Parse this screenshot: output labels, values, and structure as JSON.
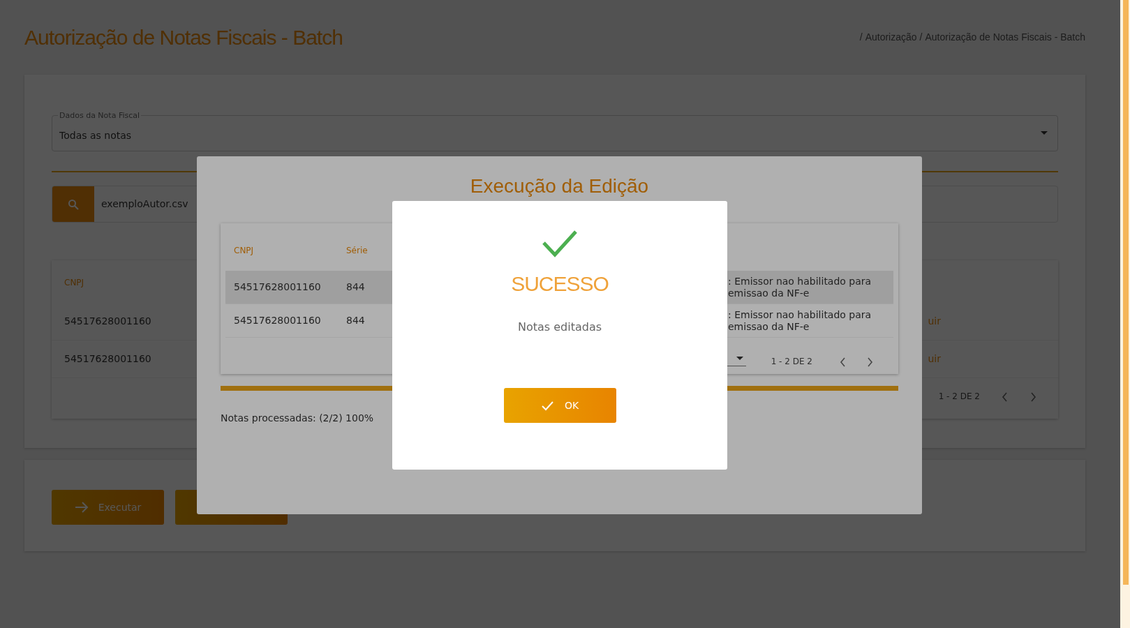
{
  "page": {
    "title": "Autorização de Notas Fiscais - Batch",
    "breadcrumb": {
      "separator": "/",
      "items": [
        "Autorização",
        "Autorização de Notas Fiscais - Batch"
      ]
    }
  },
  "filter": {
    "label": "Dados da Nota Fiscal",
    "value": "Todas as notas"
  },
  "file_search": {
    "value": "exemploAutor.csv"
  },
  "table": {
    "columns": [
      "CNPJ"
    ],
    "rows": [
      {
        "cnpj": "54517628001160",
        "action": "uir"
      },
      {
        "cnpj": "54517628001160",
        "action": "uir"
      }
    ],
    "pagination": "1 - 2 DE 2"
  },
  "actions": [
    {
      "kind": "execute",
      "label": "Executar"
    },
    {
      "kind": "clear"
    }
  ],
  "dialog": {
    "title": "Execução da Edição",
    "table": {
      "columns": [
        "CNPJ",
        "Série"
      ],
      "rows": [
        {
          "cnpj": "54517628001160",
          "serie": "844",
          "message": ": Emissor nao habilitado para emissao da NF-e",
          "highlighted": true
        },
        {
          "cnpj": "54517628001160",
          "serie": "844",
          "message": ": Emissor nao habilitado para emissao da NF-e",
          "highlighted": false
        }
      ],
      "pagination": "1 - 2 DE 2"
    },
    "progress": {
      "level": 1,
      "text": "Notas processadas: (2/2) 100%"
    }
  },
  "success": {
    "title": "SUCESSO",
    "message": "Notas editadas",
    "button": "OK"
  }
}
